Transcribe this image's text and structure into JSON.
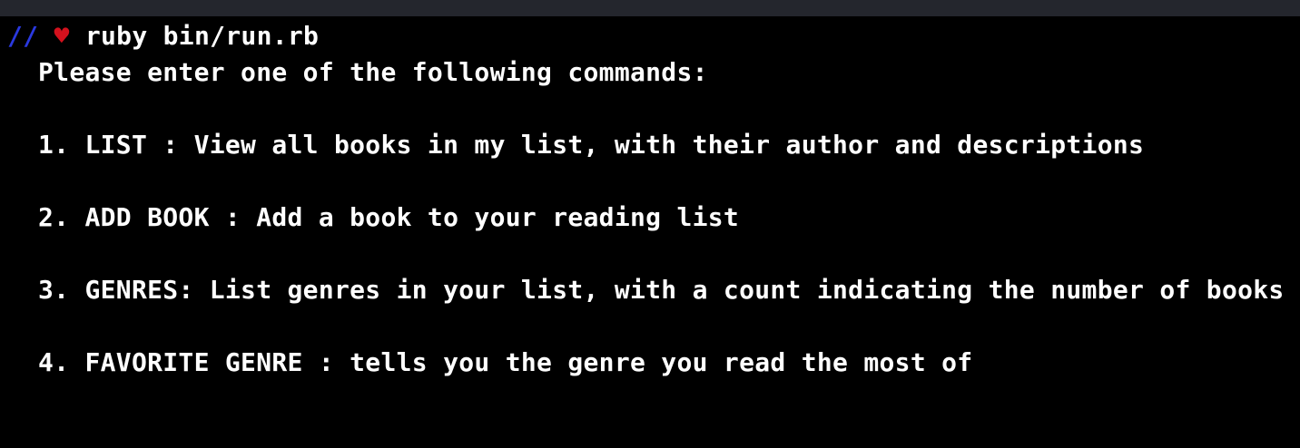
{
  "window": {
    "titlebar_color": "#24262d"
  },
  "prompt": {
    "slashes": "//",
    "heart": "♥",
    "command": "ruby bin/run.rb",
    "slashes_color": "#2a39e0",
    "heart_color": "#d4111d"
  },
  "output": {
    "intro": "Please enter one of the following commands:",
    "items": [
      "1. LIST : View all books in my list, with their author and descriptions",
      "2. ADD BOOK : Add a book to your reading list",
      "3. GENRES: List genres in your list, with a count indicating the number of books",
      "4. FAVORITE GENRE : tells you the genre you read the most of"
    ]
  }
}
